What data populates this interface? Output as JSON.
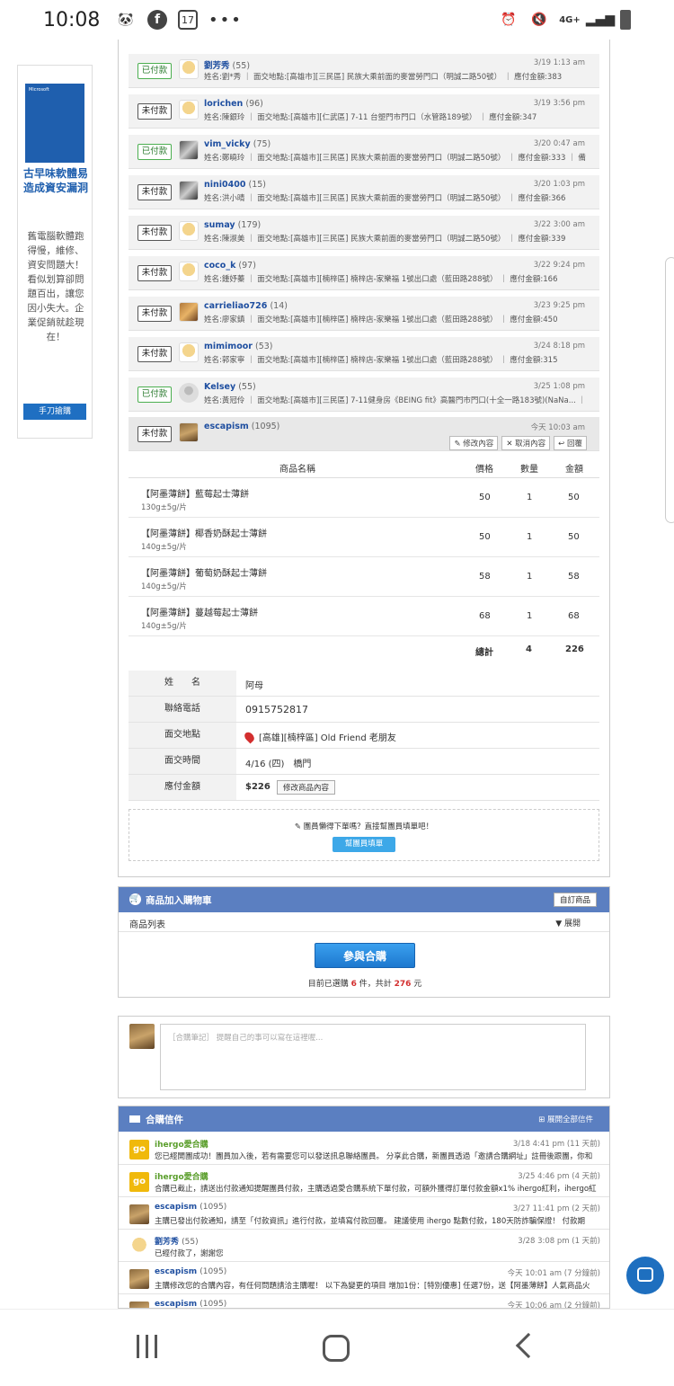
{
  "status": {
    "time": "10:08",
    "network": "4G+"
  },
  "ad": {
    "banner_brand": "Microsoft",
    "title": "古早味軟體易造成資安漏洞",
    "body": "舊電腦軟體跑得慢，維修、資安問題大！看似划算卻問題百出，讓您因小失大。企業促銷就趁現在！",
    "button": "手刀搶購"
  },
  "orders": [
    {
      "status": "已付款",
      "name": "劉芳秀",
      "count": "(55)",
      "detail": "姓名:劉*秀 ｜ 面交地點:[高雄市][三民區] 民族大乘前面的麥當勞門口（明誠二路50號） ｜ 應付金額:383",
      "date": "3/19 1:13 am",
      "avatar": "face"
    },
    {
      "status": "未付款",
      "name": "lorichen",
      "count": "(96)",
      "detail": "姓名:陳銀玲 ｜ 面交地點:[高雄市][仁武區] 7-11 台塑門市門口（水管路189號） ｜ 應付金額:347",
      "date": "3/19 3:56 pm",
      "avatar": "face"
    },
    {
      "status": "已付款",
      "name": "vim_vicky",
      "count": "(75)",
      "detail": "姓名:鄭曉玲 ｜ 面交地點:[高雄市][三民區] 民族大乘前面的麥當勞門口（明誠二路50號） ｜ 應付金額:333 ｜ 備",
      "date": "3/20 0:47 am",
      "avatar": "cat"
    },
    {
      "status": "未付款",
      "name": "nini0400",
      "count": "(15)",
      "detail": "姓名:洪小晴 ｜ 面交地點:[高雄市][三民區] 民族大乘前面的麥當勞門口（明誠二路50號） ｜ 應付金額:366",
      "date": "3/20 1:03 pm",
      "avatar": "cat"
    },
    {
      "status": "未付款",
      "name": "sumay",
      "count": "(179)",
      "detail": "姓名:陳淑美 ｜ 面交地點:[高雄市][三民區] 民族大乘前面的麥當勞門口（明誠二路50號） ｜ 應付金額:339",
      "date": "3/22 3:00 am",
      "avatar": "face"
    },
    {
      "status": "未付款",
      "name": "coco_k",
      "count": "(97)",
      "detail": "姓名:鍾妤蓁 ｜ 面交地點:[高雄市][楠梓區] 楠梓店-家樂福 1號出口處（藍田路288號） ｜ 應付金額:166",
      "date": "3/22 9:24 pm",
      "avatar": "face"
    },
    {
      "status": "未付款",
      "name": "carrieliao726",
      "count": "(14)",
      "detail": "姓名:廖家鎮 ｜ 面交地點:[高雄市][楠梓區] 楠梓店-家樂福 1號出口處（藍田路288號） ｜ 應付金額:450",
      "date": "3/23 9:25 pm",
      "avatar": "food"
    },
    {
      "status": "未付款",
      "name": "mimimoor",
      "count": "(53)",
      "detail": "姓名:郭家寧 ｜ 面交地點:[高雄市][楠梓區] 楠梓店-家樂福 1號出口處（藍田路288號） ｜ 應付金額:315",
      "date": "3/24 8:18 pm",
      "avatar": "face"
    },
    {
      "status": "已付款",
      "name": "Kelsey",
      "count": "(55)",
      "detail": "姓名:黃冠伶 ｜ 面交地點:[高雄市][三民區] 7-11健身房《BEING fit》高醫門市門口(十全一路183號)(NaNa... ｜",
      "date": "3/25 1:08 pm",
      "avatar": "grey"
    }
  ],
  "active_order": {
    "status": "未付款",
    "name": "escapism",
    "count": "(1095)",
    "date": "今天 10:03 am",
    "buttons": [
      "修改內容",
      "取消內容",
      "回覆"
    ]
  },
  "items_table": {
    "headers": [
      "商品名稱",
      "價格",
      "數量",
      "金額"
    ],
    "rows": [
      {
        "name": "【阿墨薄餅】藍莓起士薄餅",
        "spec": "130g±5g/片",
        "price": "50",
        "qty": "1",
        "amount": "50"
      },
      {
        "name": "【阿墨薄餅】椰香奶酥起士薄餅",
        "spec": "140g±5g/片",
        "price": "50",
        "qty": "1",
        "amount": "50"
      },
      {
        "name": "【阿墨薄餅】葡萄奶酥起士薄餅",
        "spec": "140g±5g/片",
        "price": "58",
        "qty": "1",
        "amount": "58"
      },
      {
        "name": "【阿墨薄餅】蔓越莓起士薄餅",
        "spec": "140g±5g/片",
        "price": "68",
        "qty": "1",
        "amount": "68"
      }
    ],
    "total_label": "總計",
    "total_qty": "4",
    "total_amount": "226"
  },
  "info": {
    "name_label": "姓　　名",
    "name_value": "阿母",
    "phone_label": "聯絡電話",
    "phone_value": "0915752817",
    "place_label": "面交地點",
    "place_value": "[高雄][楠梓區] Old Friend 老朋友",
    "time_label": "面交時間",
    "time_value": "4/16 (四)　橋門",
    "pay_label": "應付金額",
    "pay_value": "$226",
    "modify_btn": "修改商品內容"
  },
  "helper": {
    "text": "團員懶得下單嗎？直接幫團員填單吧！",
    "button": "幫團員填單"
  },
  "cart": {
    "title": "商品加入購物車",
    "order_btn": "自訂商品",
    "list_label": "商品列表",
    "expand": "▼ 展開",
    "join_btn": "參與合購",
    "joined_prefix": "目前已選購",
    "joined_count": "6",
    "joined_mid": "件，共計",
    "joined_total": "276",
    "joined_suffix": "元"
  },
  "note": {
    "placeholder": "［合購筆記］ 提醒自己的事可以寫在這裡喔..."
  },
  "messages": {
    "title": "合購信件",
    "expand_all": "展開全部信件",
    "items": [
      {
        "who": "ihergo愛合購",
        "count": "",
        "text": "您已經開團成功！團員加入後，若有需要您可以發送訊息聯絡團員。 分享此合購，新團員透過「邀請合購網址」註冊後跟團，你和",
        "when": "3/18 4:41 pm (11 天前)",
        "avatar": "go"
      },
      {
        "who": "ihergo愛合購",
        "count": "",
        "text": "合購已截止，請送出付款通知提醒團員付款，主購透過愛合購系統下單付款，可額外獲得訂單付款金額x1% ihergo紅利，ihergo紅",
        "when": "3/25 4:46 pm (4 天前)",
        "avatar": "go"
      },
      {
        "who": "escapism",
        "count": "(1095)",
        "text": "主購已發出付款通知，請至「付款資訊」進行付款，並填寫付款回覆。 建議使用 ihergo 點數付款，180天防詐騙保證！ 付款期",
        "when": "3/27 11:41 pm (2 天前)",
        "avatar": "tree"
      },
      {
        "who": "劉芳秀",
        "count": "(55)",
        "text": "已經付款了，謝謝您",
        "when": "3/28 3:08 pm (1 天前)",
        "avatar": "face"
      },
      {
        "who": "escapism",
        "count": "(1095)",
        "text": "主購修改您的合購內容，有任何問題請洽主購喔！ 以下為變更的項目 增加1份：[特別優惠] 任選7份，送【阿墨薄餅】人氣商品火",
        "when": "今天 10:01 am (7 分鐘前)",
        "avatar": "tree"
      },
      {
        "who": "escapism",
        "count": "(1095)",
        "text": "",
        "when": "今天 10:06 am (2 分鐘前)",
        "avatar": "tree"
      }
    ]
  }
}
